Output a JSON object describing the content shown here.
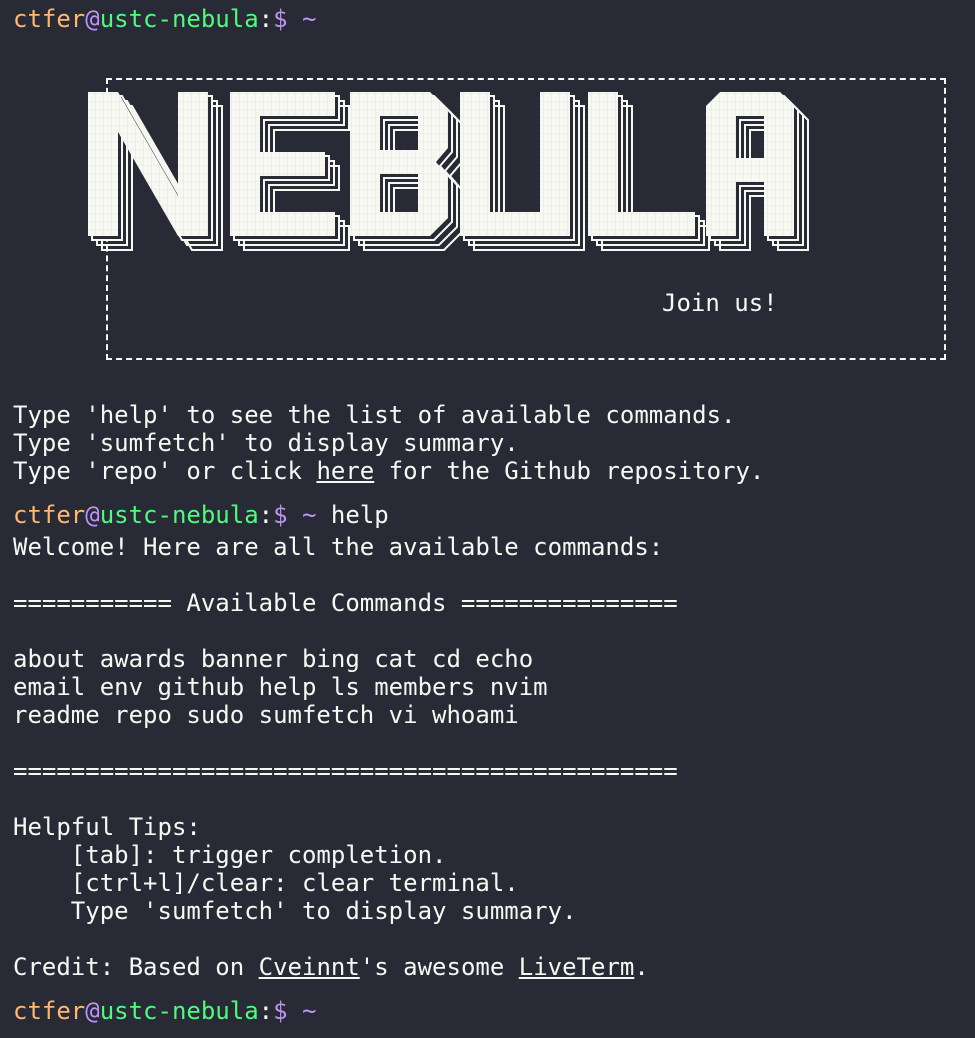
{
  "prompt": {
    "user": "ctfer",
    "at": "@",
    "host": "ustc-nebula",
    "colon": ":",
    "dollar": "$",
    "path": "~"
  },
  "banner": {
    "title": "NEBULA",
    "tagline": "Join us!"
  },
  "intro": {
    "line1": "Type 'help' to see the list of available commands.",
    "line2": "Type 'sumfetch' to display summary.",
    "line3_pre": "Type 'repo' or click ",
    "line3_link": "here",
    "line3_post": " for the Github repository."
  },
  "help_cmd": "help",
  "help_output": {
    "welcome": "Welcome! Here are all the available commands:",
    "header": "=========== Available Commands ===============",
    "commands_row1": "about awards banner bing cat cd echo",
    "commands_row2": "email env github help ls members nvim",
    "commands_row3": "readme repo sudo sumfetch vi whoami",
    "footer": "==============================================",
    "tips_title": "Helpful Tips:",
    "tip1": "    [tab]: trigger completion.",
    "tip2": "    [ctrl+l]/clear: clear terminal.",
    "tip3": "    Type 'sumfetch' to display summary.",
    "credit_pre": "Credit: Based on ",
    "credit_link1": "Cveinnt",
    "credit_mid": "'s awesome ",
    "credit_link2": "LiveTerm",
    "credit_post": "."
  },
  "colors": {
    "background": "#282a36",
    "foreground": "#f8f8f2",
    "user": "#ffb86c",
    "host": "#50fa7b",
    "accent": "#bd93f9"
  }
}
